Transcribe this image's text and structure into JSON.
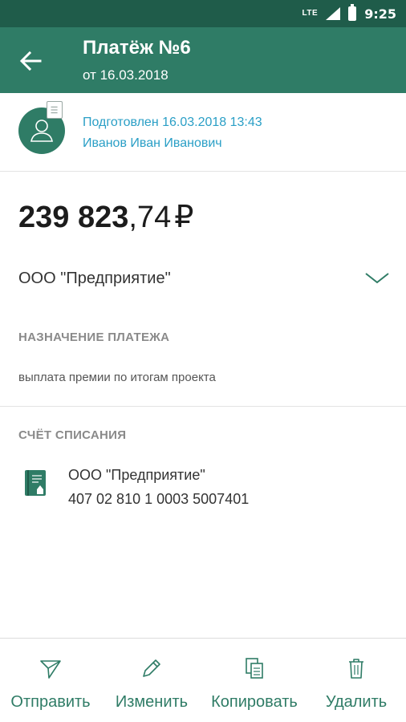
{
  "status_bar": {
    "network": "LTE",
    "time": "9:25"
  },
  "header": {
    "title": "Платёж №6",
    "subtitle": "от 16.03.2018"
  },
  "author": {
    "status": "Подготовлен 16.03.2018 13:43",
    "name": "Иванов Иван Иванович"
  },
  "payment": {
    "amount_main": "239 823",
    "amount_cents": ",74",
    "currency": "₽",
    "payee": "ООО \"Предприятие\""
  },
  "purpose": {
    "label": "НАЗНАЧЕНИЕ ПЛАТЕЖА",
    "text": "выплата премии по итогам проекта"
  },
  "debit_account": {
    "label": "СЧЁТ СПИСАНИЯ",
    "name": "ООО \"Предприятие\"",
    "number": "407 02 810 1 0003 5007401"
  },
  "actions": {
    "send": "Отправить",
    "edit": "Изменить",
    "copy": "Копировать",
    "delete": "Удалить"
  },
  "colors": {
    "primary": "#2f7c66",
    "status_bar": "#1f5c4a",
    "link": "#2a9fc6"
  }
}
